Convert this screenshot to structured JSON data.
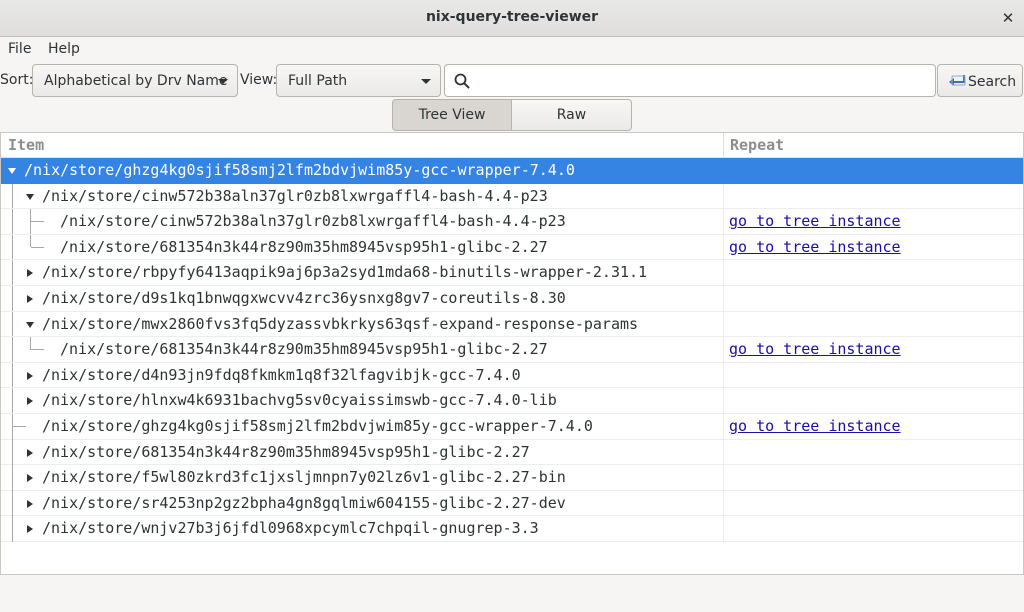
{
  "window": {
    "title": "nix-query-tree-viewer"
  },
  "menu": {
    "file": "File",
    "help": "Help"
  },
  "toolbar": {
    "sort_label": "Sort:",
    "sort_value": "Alphabetical by Drv Name",
    "view_label": "View:",
    "view_value": "Full Path",
    "search_value": "",
    "search_button": "Search"
  },
  "view_switcher": {
    "tree": "Tree View",
    "raw": "Raw"
  },
  "tree": {
    "columns": {
      "item": "Item",
      "repeat": "Repeat"
    },
    "rows": [
      {
        "path": "/nix/store/ghzg4kg0sjif58smj2lfm2bdvjwim85y-gcc-wrapper-7.4.0",
        "repeat": "",
        "expander": "expanded",
        "selected": true
      },
      {
        "path": "/nix/store/cinw572b38aln37glr0zb8lxwrgaffl4-bash-4.4-p23",
        "repeat": "",
        "expander": "expanded"
      },
      {
        "path": "/nix/store/cinw572b38aln37glr0zb8lxwrgaffl4-bash-4.4-p23",
        "repeat": "go to tree instance",
        "expander": "none"
      },
      {
        "path": "/nix/store/681354n3k44r8z90m35hm8945vsp95h1-glibc-2.27",
        "repeat": "go to tree instance",
        "expander": "none"
      },
      {
        "path": "/nix/store/rbpyfy6413aqpik9aj6p3a2syd1mda68-binutils-wrapper-2.31.1",
        "repeat": "",
        "expander": "collapsed"
      },
      {
        "path": "/nix/store/d9s1kq1bnwqgxwcvv4zrc36ysnxg8gv7-coreutils-8.30",
        "repeat": "",
        "expander": "collapsed"
      },
      {
        "path": "/nix/store/mwx2860fvs3fq5dyzassvbkrkys63qsf-expand-response-params",
        "repeat": "",
        "expander": "expanded"
      },
      {
        "path": "/nix/store/681354n3k44r8z90m35hm8945vsp95h1-glibc-2.27",
        "repeat": "go to tree instance",
        "expander": "none"
      },
      {
        "path": "/nix/store/d4n93jn9fdq8fkmkm1q8f32lfagvibjk-gcc-7.4.0",
        "repeat": "",
        "expander": "collapsed"
      },
      {
        "path": "/nix/store/hlnxw4k6931bachvg5sv0cyaissimswb-gcc-7.4.0-lib",
        "repeat": "",
        "expander": "collapsed"
      },
      {
        "path": "/nix/store/ghzg4kg0sjif58smj2lfm2bdvjwim85y-gcc-wrapper-7.4.0",
        "repeat": "go to tree instance",
        "expander": "none"
      },
      {
        "path": "/nix/store/681354n3k44r8z90m35hm8945vsp95h1-glibc-2.27",
        "repeat": "",
        "expander": "collapsed"
      },
      {
        "path": "/nix/store/f5wl80zkrd3fc1jxsljmnpn7y02lz6v1-glibc-2.27-bin",
        "repeat": "",
        "expander": "collapsed"
      },
      {
        "path": "/nix/store/sr4253np2gz2bpha4gn8gqlmiw604155-glibc-2.27-dev",
        "repeat": "",
        "expander": "collapsed"
      },
      {
        "path": "/nix/store/wnjv27b3j6jfdl0968xpcymlc7chpqil-gnugrep-3.3",
        "repeat": "",
        "expander": "collapsed"
      }
    ]
  },
  "colors": {
    "selection": "#3584e4",
    "link": "#1a0dab"
  }
}
